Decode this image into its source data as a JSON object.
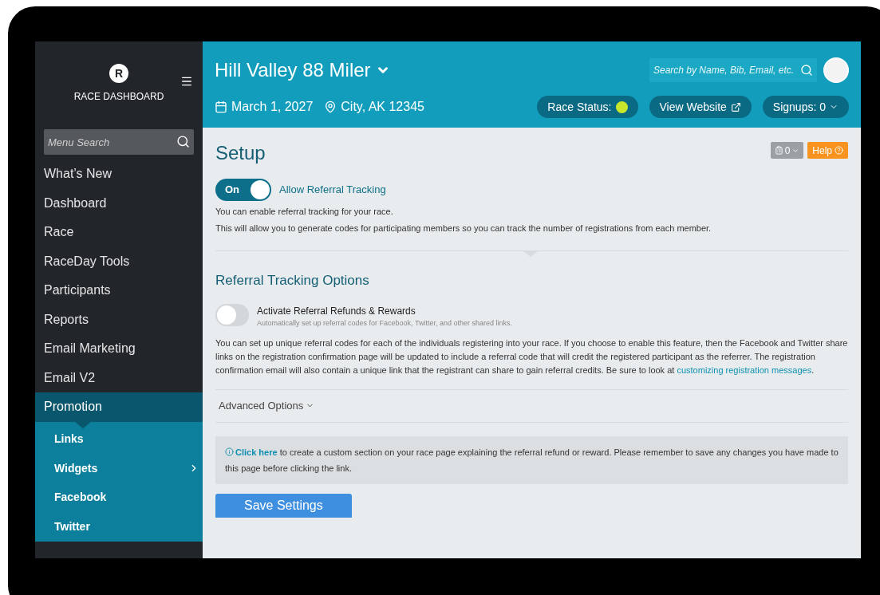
{
  "sidebar": {
    "brand_letter": "R",
    "brand": "RACE DASHBOARD",
    "search": {
      "placeholder": "Menu Search"
    },
    "items": [
      {
        "label": "What’s New",
        "selected": false
      },
      {
        "label": "Dashboard",
        "selected": false
      },
      {
        "label": "Race",
        "selected": false
      },
      {
        "label": "RaceDay Tools",
        "selected": false
      },
      {
        "label": "Participants",
        "selected": false
      },
      {
        "label": "Reports",
        "selected": false
      },
      {
        "label": "Email Marketing",
        "selected": false
      },
      {
        "label": "Email V2",
        "selected": false
      },
      {
        "label": "Promotion",
        "selected": true,
        "expanded": true,
        "children": [
          {
            "label": "Links",
            "has_submenu": false
          },
          {
            "label": "Widgets",
            "has_submenu": true
          },
          {
            "label": "Facebook",
            "has_submenu": false
          },
          {
            "label": "Twitter",
            "has_submenu": false
          }
        ]
      }
    ]
  },
  "header": {
    "race_name": "Hill Valley 88 Miler",
    "date": "March 1, 2027",
    "location": "City, AK 12345",
    "search": {
      "placeholder": "Search by Name, Bib, Email, etc."
    },
    "race_status": {
      "label": "Race Status:",
      "color": "#c8e62c"
    },
    "view_website": "View Website",
    "signups": "Signups: 0"
  },
  "page": {
    "title": "Setup",
    "counter": "0",
    "help": "Help",
    "referral_toggle": {
      "on": true,
      "on_label": "On",
      "label": "Allow Referral Tracking"
    },
    "intro": [
      "You can enable referral tracking for your race.",
      "This will allow you to generate codes for participating members so you can track the number of registrations from each member."
    ],
    "options_title": "Referral Tracking Options",
    "rewards_toggle": {
      "on": false,
      "label": "Activate Referral Refunds & Rewards",
      "hint": "Automatically set up referral codes for Facebook, Twitter, and other shared links."
    },
    "description": "You can set up unique referral codes for each of the individuals registering into your race. If you choose to enable this feature, then the Facebook and Twitter share links on the registration confirmation page will be updated to include a referral code that will credit the registered participant as the referrer. The registration confirmation email will also contain a unique link that the registrant can share to gain referral credits. Be sure to look at",
    "description_link": "customizing registration messages",
    "description_end": ".",
    "advanced": {
      "label": "Advanced Options",
      "expanded": false
    },
    "info": {
      "link": "Click here",
      "text": "to create a custom section on your race page explaining the referral refund or reward. Please remember to save any changes you have made to this page before clicking the link."
    },
    "save": "Save Settings"
  }
}
